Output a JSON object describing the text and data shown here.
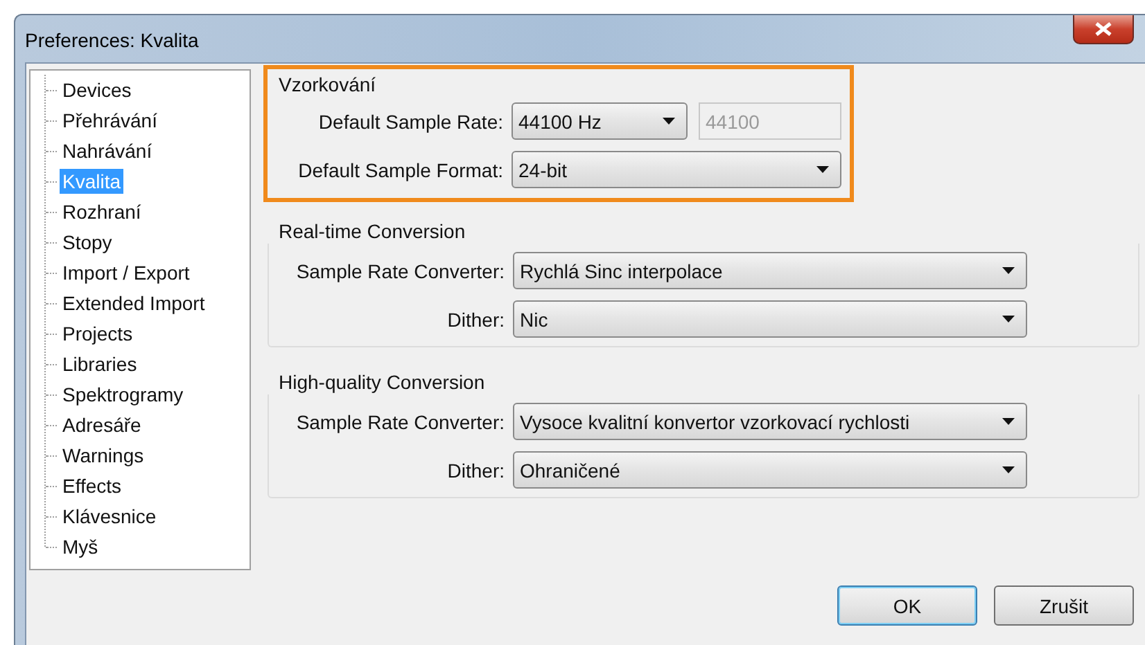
{
  "window": {
    "title": "Preferences: Kvalita"
  },
  "sidebar": {
    "items": [
      {
        "label": "Devices",
        "selected": false
      },
      {
        "label": "Přehrávání",
        "selected": false
      },
      {
        "label": "Nahrávání",
        "selected": false
      },
      {
        "label": "Kvalita",
        "selected": true
      },
      {
        "label": "Rozhraní",
        "selected": false
      },
      {
        "label": "Stopy",
        "selected": false
      },
      {
        "label": "Import / Export",
        "selected": false
      },
      {
        "label": "Extended Import",
        "selected": false
      },
      {
        "label": "Projects",
        "selected": false
      },
      {
        "label": "Libraries",
        "selected": false
      },
      {
        "label": "Spektrogramy",
        "selected": false
      },
      {
        "label": "Adresáře",
        "selected": false
      },
      {
        "label": "Warnings",
        "selected": false
      },
      {
        "label": "Effects",
        "selected": false
      },
      {
        "label": "Klávesnice",
        "selected": false
      },
      {
        "label": "Myš",
        "selected": false
      }
    ]
  },
  "groups": [
    {
      "title": "Vzorkování",
      "highlighted": true,
      "rows": [
        {
          "label": "Default Sample Rate:",
          "dropdown": {
            "value": "44100 Hz"
          },
          "field": {
            "value": "44100",
            "disabled": true
          }
        },
        {
          "label": "Default Sample Format:",
          "dropdown": {
            "value": "24-bit"
          }
        }
      ]
    },
    {
      "title": "Real-time Conversion",
      "highlighted": false,
      "rows": [
        {
          "label": "Sample Rate Converter:",
          "dropdown": {
            "value": "Rychlá Sinc interpolace"
          }
        },
        {
          "label": "Dither:",
          "dropdown": {
            "value": "Nic"
          }
        }
      ]
    },
    {
      "title": "High-quality Conversion",
      "highlighted": false,
      "rows": [
        {
          "label": "Sample Rate Converter:",
          "dropdown": {
            "value": "Vysoce kvalitní konvertor vzorkovací rychlosti"
          }
        },
        {
          "label": "Dither:",
          "dropdown": {
            "value": "Ohraničené"
          }
        }
      ]
    }
  ],
  "buttons": [
    {
      "label": "OK",
      "default": true
    },
    {
      "label": "Zrušit",
      "default": false
    }
  ]
}
